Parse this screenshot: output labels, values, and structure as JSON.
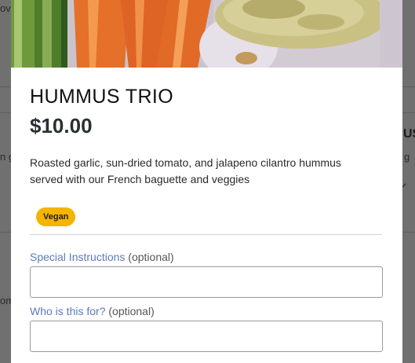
{
  "background": {
    "left_texts": [
      "ov",
      "n g",
      "om"
    ],
    "right_texts": [
      "US",
      "g"
    ],
    "right_icon": "chevron-down-icon"
  },
  "item": {
    "image_alt": "hummus-trio-photo",
    "title": "HUMMUS TRIO",
    "price": "$10.00",
    "description": "Roasted garlic, sun-dried tomato, and jalapeno cilantro hummus served with our French baguette and veggies",
    "badge": "Vegan"
  },
  "form": {
    "special_instructions": {
      "label": "Special Instructions",
      "optional": "(optional)",
      "value": "",
      "placeholder": ""
    },
    "who_for": {
      "label": "Who is this for?",
      "optional": "(optional)",
      "value": "",
      "placeholder": ""
    }
  },
  "colors": {
    "accent_label": "#5b7bbd",
    "badge_bg": "#f5b400",
    "backdrop": "#737373"
  }
}
